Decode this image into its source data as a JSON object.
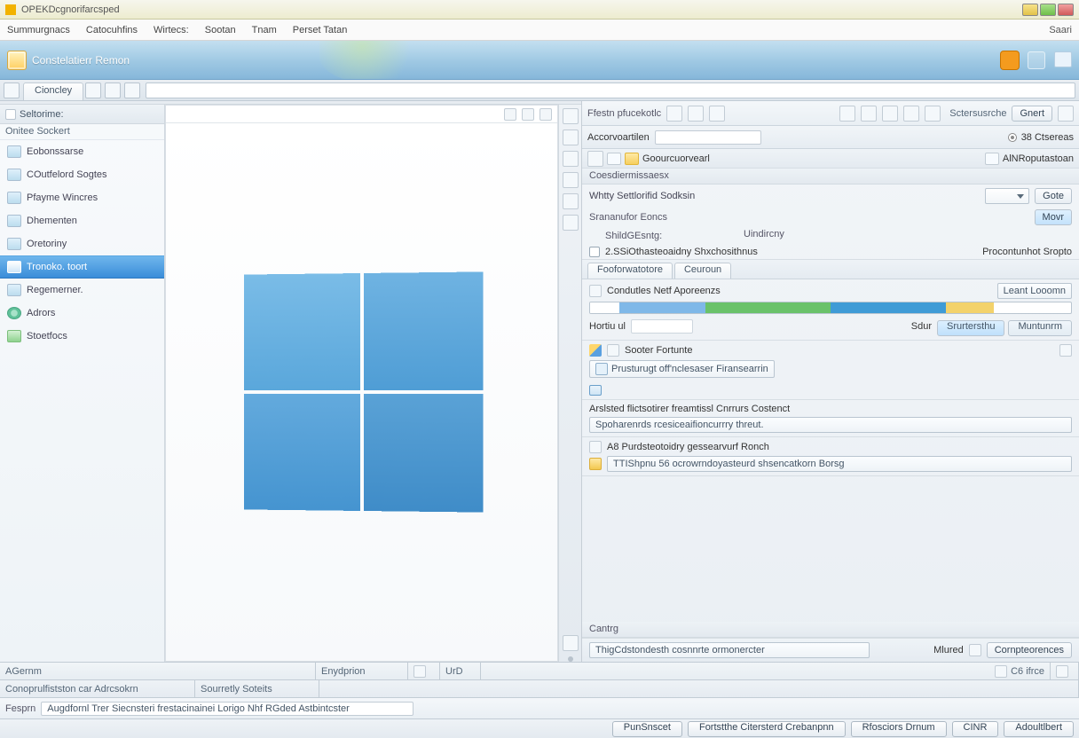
{
  "window": {
    "title": "OPEKDcgnorifarcsped"
  },
  "menu": {
    "items": [
      "Summurgnacs",
      "Catocuhfins",
      "Wirtecs:",
      "Sootan",
      "Tnam",
      "Perset Tatan"
    ],
    "right": "Saari"
  },
  "ribbon": {
    "title": "Constelatierr Remon"
  },
  "tabs": {
    "main": "Cioncley"
  },
  "sidebar": {
    "header": "Seltorime:",
    "subheader": "Onitee Sockert",
    "items": [
      {
        "label": "Eobonssarse"
      },
      {
        "label": "COutfelord Sogtes"
      },
      {
        "label": "Pfayme Wincres"
      },
      {
        "label": "Dhementen"
      },
      {
        "label": "Oretoriny"
      },
      {
        "label": "Tronoko. toort"
      },
      {
        "label": "Regemerner."
      },
      {
        "label": "Adrors"
      },
      {
        "label": "Stoetfocs"
      }
    ]
  },
  "preview": {
    "barLabel": ""
  },
  "right": {
    "toolbar": {
      "left": "Ffestn pfucekotlc",
      "right": "Sctersusrche",
      "btn": "Gnert"
    },
    "row2": {
      "label": "Accorvoartilen",
      "radio": "38 Ctsereas"
    },
    "path": {
      "a": "Goourcuorvearl",
      "b": "AlNRoputastoan"
    },
    "section": "Coesdiermissaesx",
    "group1": {
      "title": "Whtty Settlorifid Sodksin",
      "side": "Gote",
      "r1": "Srananufor Eoncs",
      "tab1": "Movr",
      "r2k": "ShildGEsntg:",
      "r2v": "Uindircny",
      "r3a": "2.SSiOthasteoaidny Shxchosithnus",
      "r3b": "Procontunhot Sropto"
    },
    "innerTabs": [
      "Fooforwatotore",
      "Ceuroun"
    ],
    "panel2": {
      "title": "Condutles Netf Aporeenzs",
      "bar_legend": "Leant Looomn",
      "k": "Hortiu ul",
      "v": "Sdur",
      "btn1": "Srurtersthu",
      "btn2": "Muntunrm"
    },
    "panel3": {
      "title": "Sooter Fortunte",
      "box": "Prusturugt off'nclesaser Firansearrin"
    },
    "panel4": {
      "line": "Arslsted flictsotirer freamtissl Cnrrurs Costenct",
      "box": "Spoharenrds rcesiceaifioncurrry threut."
    },
    "panel5": {
      "line": "A8 Purdsteotoidry gessearvurf Ronch",
      "box": "TTIShpnu 56 ocrowrndoyasteurd shsencatkorn Borsg"
    },
    "cantag": "Cantrg",
    "field": "ThigCdstondesth cosnnrte ormonercter"
  },
  "status": {
    "l1": "AGernm",
    "l2": "Enydprion",
    "l3": "UrD",
    "r_icon": "C6 ifrce"
  },
  "status2": {
    "a": "Conoprulfistston car Adrcsokrn",
    "b": "Sourretly Soteits"
  },
  "footer": {
    "label": "Fesprn",
    "long": "Augdfornl Trer Siecnsteri frestacinainei Lorigo Nhf RGded Astbintcster",
    "mid": "Mlured",
    "r1": "Cornpteorences",
    "b1": "PunSnscet",
    "b2": "Fortstthe Citersterd Crebanpnn",
    "b3": "Rfosciors Drnum",
    "b4": "CINR",
    "b5": "Adoultlbert"
  }
}
